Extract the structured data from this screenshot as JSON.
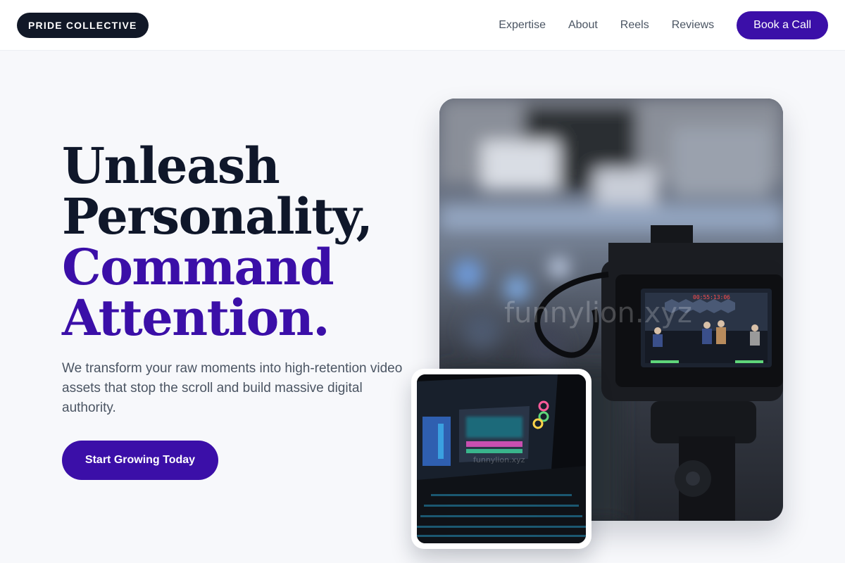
{
  "header": {
    "brand": "PRIDE COLLECTIVE",
    "nav": [
      {
        "label": "Expertise"
      },
      {
        "label": "About"
      },
      {
        "label": "Reels"
      },
      {
        "label": "Reviews"
      }
    ],
    "cta_label": "Book a Call"
  },
  "hero": {
    "headline_line1": "Unleash",
    "headline_line2": "Personality,",
    "headline_line3": "Command",
    "headline_line4": "Attention.",
    "subtext": "We transform your raw moments into high-retention video assets that stop the scroll and build massive digital authority.",
    "cta_label": "Start Growing Today"
  },
  "images": {
    "main_watermark": "funnylion.xyz",
    "main_timecode": "00:55:13:06",
    "inset_watermark": "funnylion.xyz"
  },
  "colors": {
    "accent": "#3b0fa8",
    "dark": "#0f172a",
    "muted": "#4b5563",
    "background": "#f7f8fb"
  }
}
